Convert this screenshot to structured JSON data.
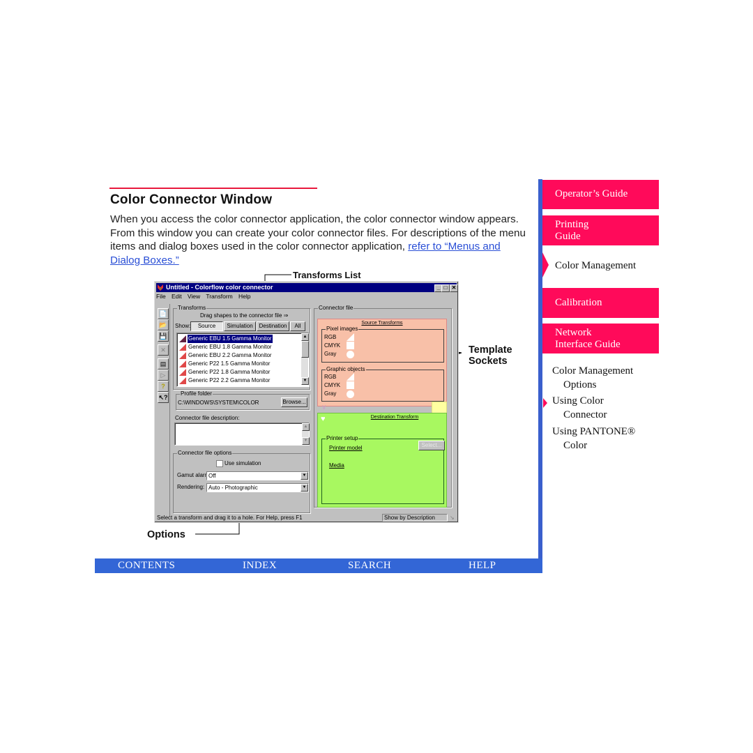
{
  "heading": {
    "title": "Color Connector Window",
    "body_text": "When you access the color connector application, the color connector window appears. From this window you can create your color connector files. For descriptions of the menu items and dialog boxes used in the color connector application, ",
    "link_text": "refer to “Menus and Dialog Boxes.”"
  },
  "callouts": {
    "transforms_list": "Transforms List",
    "template": "Template",
    "sockets": "Sockets",
    "options": "Options"
  },
  "window": {
    "title": "Untitled - Colorflow color connector",
    "controls": {
      "minimize": "_",
      "maximize": "□",
      "close": "✕"
    },
    "menu": [
      "File",
      "Edit",
      "View",
      "Transform",
      "Help"
    ],
    "toolbar_icons": [
      "new-file-icon",
      "open-folder-icon",
      "save-disk-icon",
      "delete-x-icon",
      "properties-icon",
      "plug-icon",
      "help-question-icon",
      "context-help-icon"
    ],
    "transforms": {
      "group_label": "Transforms",
      "drag_hint": "Drag shapes to the connector file ⇒",
      "show_label": "Show:",
      "show_buttons": [
        "Source",
        "Simulation",
        "Destination",
        "All"
      ],
      "selected_show": "Source",
      "items": [
        "Generic EBU 1.5 Gamma Monitor",
        "Generic EBU 1.8 Gamma Monitor",
        "Generic EBU 2.2 Gamma Monitor",
        "Generic P22 1.5 Gamma Monitor",
        "Generic P22 1.8 Gamma Monitor",
        "Generic P22 2.2 Gamma Monitor"
      ],
      "selected_item": "Generic EBU 1.5 Gamma Monitor"
    },
    "profile_folder": {
      "label": "Profile folder",
      "path": "C:\\WINDOWS\\SYSTEM\\COLOR",
      "browse": "Browse..."
    },
    "description": {
      "label": "Connector file description:",
      "value": ""
    },
    "options": {
      "group_label": "Connector file options",
      "use_simulation_label": "Use simulation",
      "use_simulation_checked": false,
      "gamut_alarm_label": "Gamut alarm:",
      "gamut_alarm_value": "Off",
      "rendering_label": "Rendering:",
      "rendering_value": "Auto - Photographic"
    },
    "connector_file": {
      "group_label": "Connector file",
      "source_title": "Source Transforms",
      "pixel_images_label": "Pixel images",
      "graphic_objects_label": "Graphic objects",
      "socket_rows": [
        "RGB",
        "CMYK",
        "Gray"
      ],
      "destination_title": "Destination Transform",
      "printer_setup_label": "Printer setup",
      "printer_model": "Printer model",
      "media": "Media",
      "select_button": "Select..."
    },
    "status": {
      "message": "Select a transform and drag it to a hole. For Help, press F1",
      "mode": "Show by Description"
    }
  },
  "sidebar": {
    "tabs": [
      {
        "label": "Operator’s Guide"
      },
      {
        "label": "Printing Guide",
        "line1": "Printing",
        "line2": "Guide"
      },
      {
        "label": "Color Management",
        "active": true
      },
      {
        "label": "Calibration"
      },
      {
        "label": "Network Interface Guide",
        "line1": "Network",
        "line2": "Interface Guide"
      }
    ],
    "subitems": [
      {
        "line1": "Color Management",
        "line2": "Options"
      },
      {
        "line1": "Using Color",
        "line2": "Connector",
        "active": true
      },
      {
        "line1": "Using PANTONE®",
        "line2": "Color"
      }
    ]
  },
  "nav": [
    "CONTENTS",
    "INDEX",
    "SEARCH",
    "HELP"
  ],
  "colors": {
    "accent_red": "#ff0a5a",
    "nav_blue": "#3366d6",
    "link_blue": "#2a4fd6",
    "source_panel": "#f8c0a8",
    "destination_panel": "#a8f860"
  }
}
